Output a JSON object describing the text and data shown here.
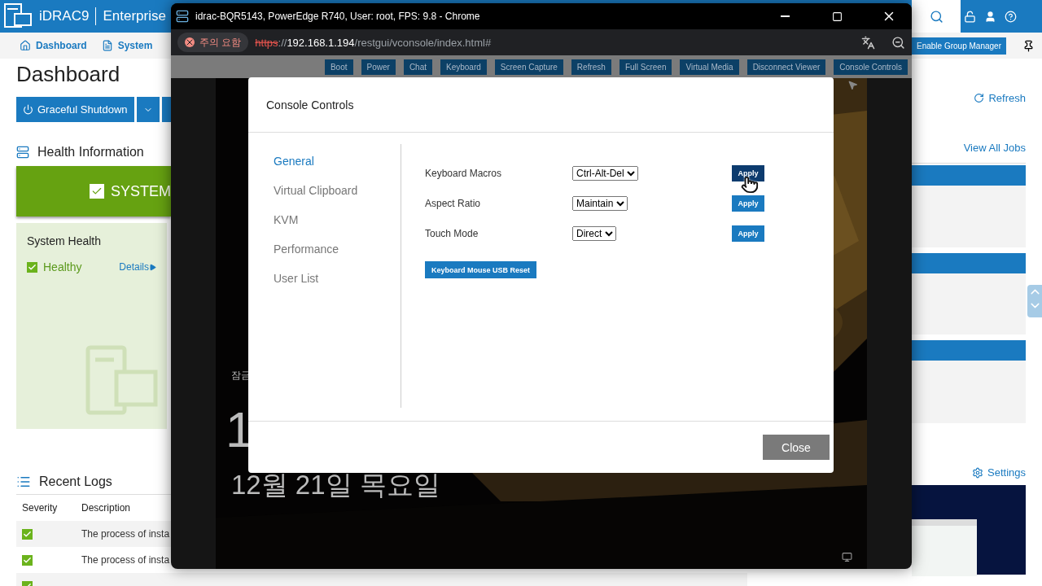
{
  "app": {
    "brand": "iDRAC9",
    "edition": "Enterprise"
  },
  "nav": [
    {
      "label": "Dashboard"
    },
    {
      "label": "System"
    }
  ],
  "group_manager": "Enable Group Manager",
  "page": {
    "title": "Dashboard",
    "power_action": "Graceful Shutdown",
    "refresh": "Refresh"
  },
  "health": {
    "title": "Health Information",
    "status": "SYSTEM",
    "panel_title": "System Health",
    "state": "Healthy",
    "details": "Details"
  },
  "jobs": {
    "link": "View All Jobs"
  },
  "logs": {
    "title": "Recent Logs",
    "columns": [
      "Severity",
      "Description"
    ],
    "rows": [
      {
        "kind": "ok",
        "description": "The process of insta"
      },
      {
        "kind": "ok",
        "description": "The process of insta"
      },
      {
        "kind": "ok"
      }
    ]
  },
  "console_preview": {
    "settings": "Settings"
  },
  "browser": {
    "title": "idrac-BQR5143, PowerEdge R740, User: root, FPS: 9.8 - Chrome",
    "security": "주의 요함",
    "url": {
      "scheme": "https",
      "separator": "://",
      "host": "192.168.1.194",
      "path": "/restgui/vconsole/index.html#"
    }
  },
  "toolbar": [
    "Boot",
    "Power",
    "Chat",
    "Keyboard",
    "Screen Capture",
    "Refresh",
    "Full Screen",
    "Virtual Media",
    "Disconnect Viewer",
    "Console Controls"
  ],
  "lock_screen": {
    "notice": "잠금",
    "time": "1",
    "date": "12월 21일 목요일"
  },
  "dialog": {
    "title": "Console Controls",
    "tabs": [
      {
        "label": "General",
        "selected": true
      },
      {
        "label": "Virtual Clipboard",
        "selected": false
      },
      {
        "label": "KVM",
        "selected": false
      },
      {
        "label": "Performance",
        "selected": false
      },
      {
        "label": "User List",
        "selected": false
      }
    ],
    "settings": [
      {
        "label": "Keyboard Macros",
        "value": "Ctrl-Alt-Del",
        "action": "Apply",
        "hovered": true
      },
      {
        "label": "Aspect Ratio",
        "value": "Maintain",
        "action": "Apply",
        "hovered": false
      },
      {
        "label": "Touch Mode",
        "value": "Direct",
        "action": "Apply",
        "hovered": false
      }
    ],
    "reset": "Keyboard Mouse USB Reset",
    "close": "Close"
  }
}
